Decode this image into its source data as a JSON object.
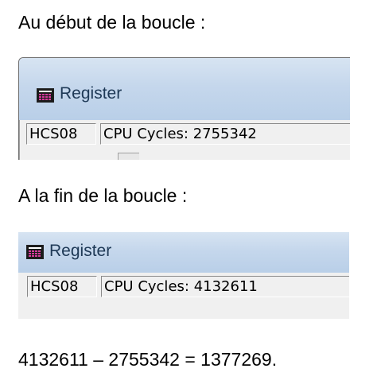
{
  "doc": {
    "label_start": "Au début de la boucle :",
    "label_end": "A la fin de la boucle :",
    "result": "4132611 – 2755342 = 1377269."
  },
  "screenshots": [
    {
      "window_title": "Register",
      "icon": "register-window-icon",
      "status": {
        "cpu": "HCS08",
        "cycles_label": "CPU Cycles:",
        "cycles_value": "2755342"
      }
    },
    {
      "window_title": "Register",
      "icon": "register-window-icon",
      "status": {
        "cpu": "HCS08",
        "cycles_label": "CPU Cycles:",
        "cycles_value": "4132611"
      }
    }
  ],
  "colors": {
    "titlebar": "#c5d7ec",
    "title_text": "#1e3956",
    "panel": "#f0f0f0"
  }
}
